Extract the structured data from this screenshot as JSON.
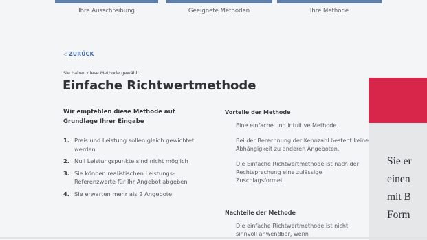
{
  "steps": [
    {
      "label": "Ihre Ausschreibung"
    },
    {
      "label": "Geeignete Methoden"
    },
    {
      "label": "Ihre Methode"
    }
  ],
  "back_link": {
    "icon": "triangle-left-icon",
    "label": "ZURÜCK"
  },
  "chosen_label": "Sie haben diese Methode gewählt:",
  "method_title": "Einfache Richtwertmethode",
  "recommendation": {
    "heading": "Wir empfehlen diese Methode auf Grundlage Ihrer Eingabe",
    "items": [
      {
        "num": "1.",
        "text": "Preis und Leistung sollen gleich gewichtet werden"
      },
      {
        "num": "2.",
        "text": "Null Leistungspunkte sind nicht möglich"
      },
      {
        "num": "3.",
        "text": "Sie können realistischen Leistungs-Referenzwerte für Ihr Angebot abgeben"
      },
      {
        "num": "4.",
        "text": "Sie erwarten mehr als 2 Angebote"
      }
    ]
  },
  "advantages": {
    "heading": "Vorteile der Methode",
    "items": [
      "Eine einfache und intuitive Methode.",
      "Bei der Berechnung der Kennzahl besteht keine Abhängigkeit zu anderen Angeboten.",
      "Die Einfache Richtwertmethode ist nach der Rechtsprechung eine zulässige Zuschlagsformel."
    ]
  },
  "disadvantages": {
    "heading": "Nachteile der Methode",
    "items": [
      "Die einfache Richtwertmethode ist nicht sinnvoll anwendbar, wenn"
    ]
  },
  "promo": {
    "lines": [
      "Sie er",
      "einen",
      "mit B",
      "Form"
    ]
  },
  "colors": {
    "step_bar": "#5f7fa8",
    "link": "#3d6aa5",
    "promo_red": "#d8254a",
    "promo_gray": "#e6e7e8",
    "background": "#f4f5f6"
  }
}
